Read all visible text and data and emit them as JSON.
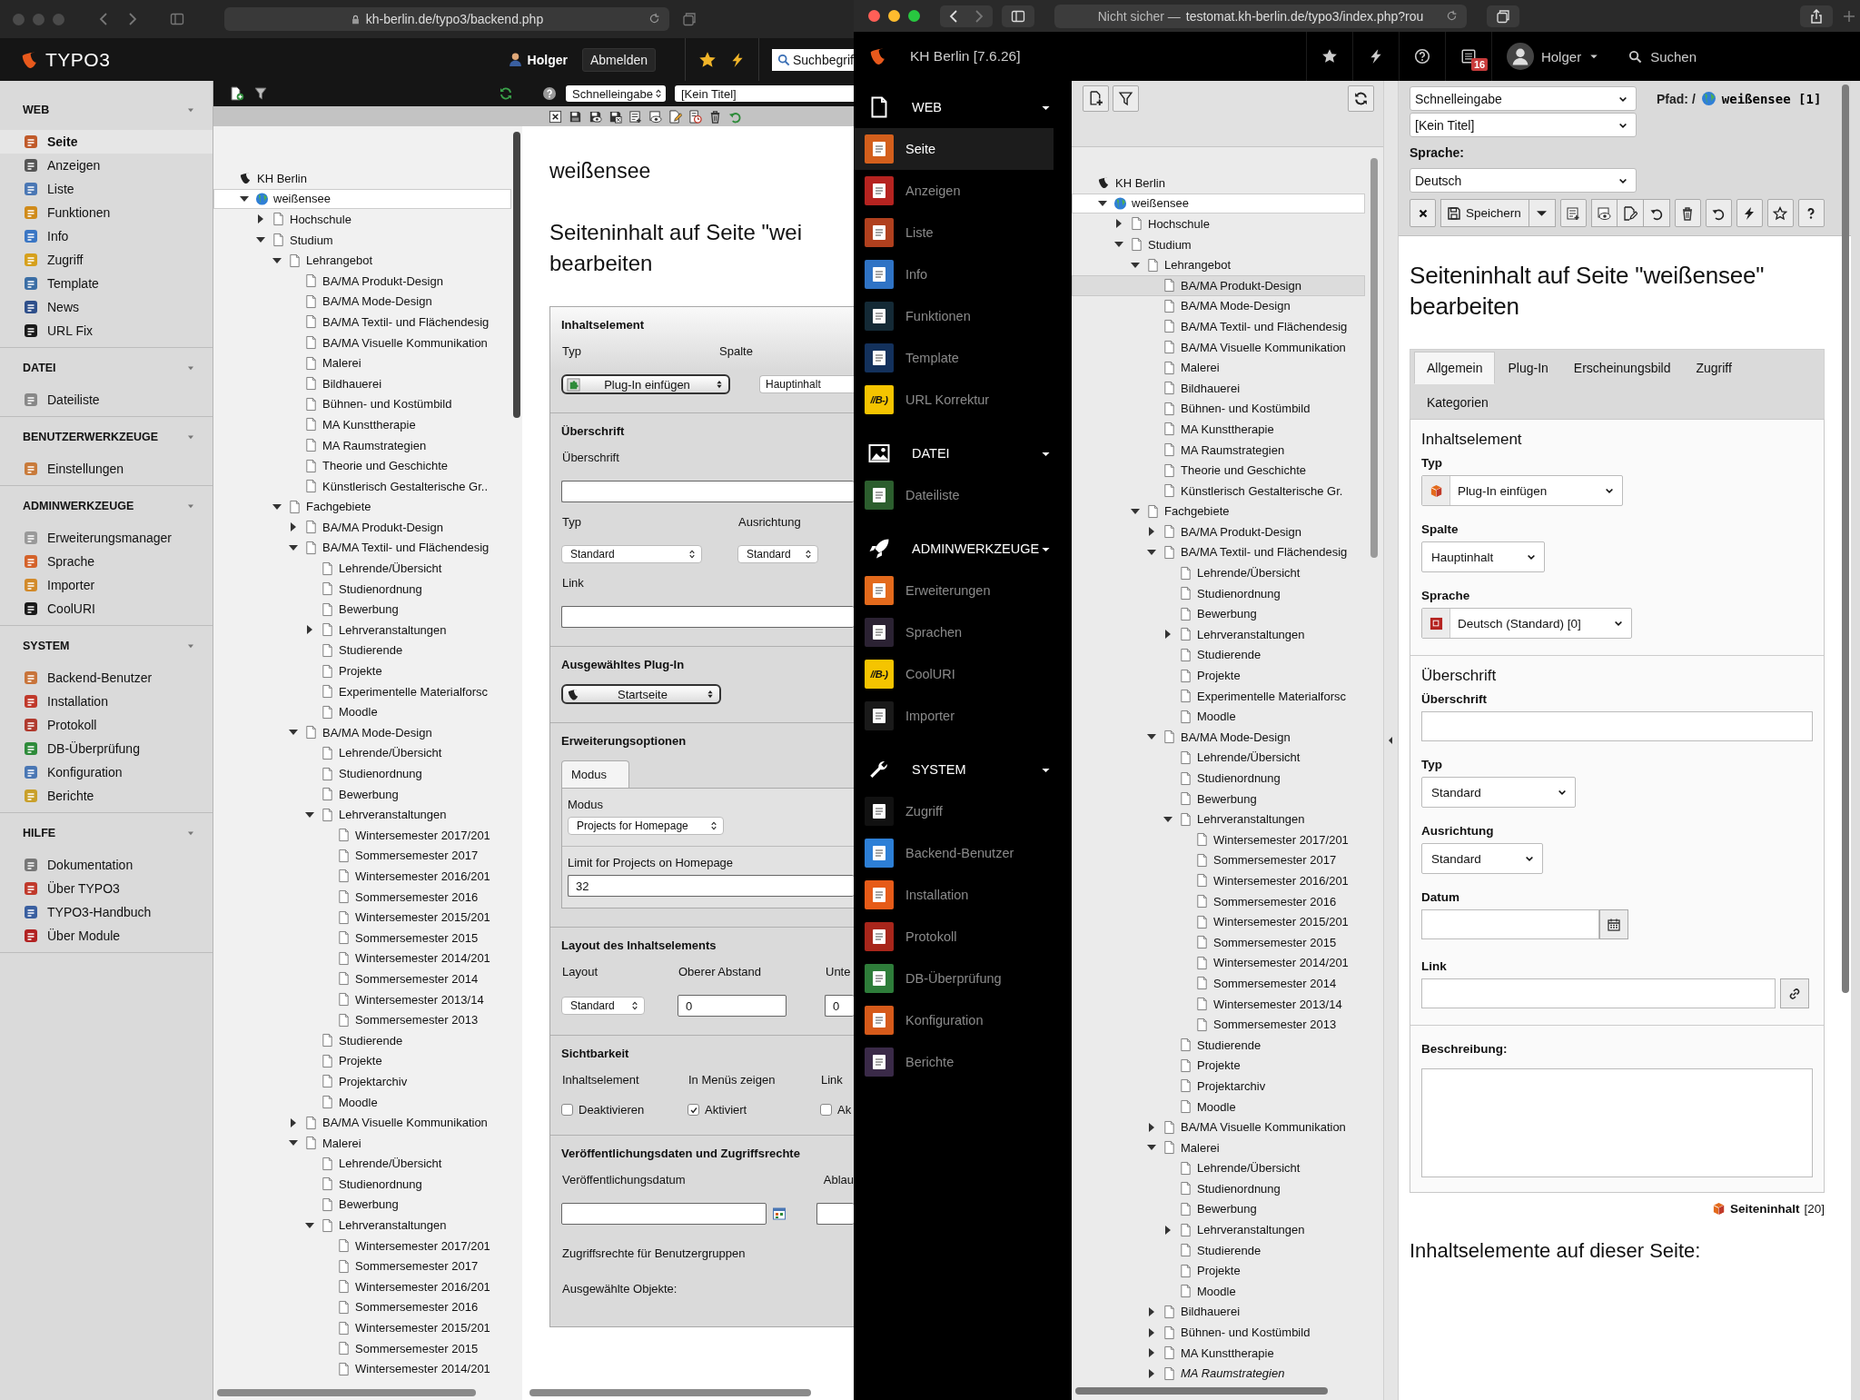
{
  "left_window": {
    "address_bar": "kh-berlin.de/typo3/backend.php",
    "brand": "TYPO3",
    "user": "Holger",
    "logout_button": "Abmelden",
    "search": {
      "value": "Suchbegrif"
    },
    "modules": [
      {
        "title": "WEB",
        "items": [
          {
            "label": "Seite",
            "selected": true,
            "color": "#c05a2a"
          },
          {
            "label": "Anzeigen",
            "selected": false,
            "color": "#555555"
          },
          {
            "label": "Liste",
            "selected": false,
            "color": "#4a77b4"
          },
          {
            "label": "Funktionen",
            "selected": false,
            "color": "#d08b1a"
          },
          {
            "label": "Info",
            "selected": false,
            "color": "#3a76c4"
          },
          {
            "label": "Zugriff",
            "selected": false,
            "color": "#d6a01c"
          },
          {
            "label": "Template",
            "selected": false,
            "color": "#3b6ea5"
          },
          {
            "label": "News",
            "selected": false,
            "color": "#2e4f8a"
          },
          {
            "label": "URL Fix",
            "selected": false,
            "color": "#1a1a1a"
          }
        ]
      },
      {
        "title": "DATEI",
        "items": [
          {
            "label": "Dateiliste",
            "selected": false,
            "color": "#888888"
          }
        ]
      },
      {
        "title": "BENUTZERWERKZEUGE",
        "items": [
          {
            "label": "Einstellungen",
            "selected": false,
            "color": "#c87a3a"
          }
        ]
      },
      {
        "title": "ADMINWERKZEUGE",
        "items": [
          {
            "label": "Erweiterungsmanager",
            "selected": false,
            "color": "#999999"
          },
          {
            "label": "Sprache",
            "selected": false,
            "color": "#d4622a"
          },
          {
            "label": "Importer",
            "selected": false,
            "color": "#d28a2a"
          },
          {
            "label": "CoolURI",
            "selected": false,
            "color": "#1a1a1a"
          }
        ]
      },
      {
        "title": "SYSTEM",
        "items": [
          {
            "label": "Backend-Benutzer",
            "selected": false,
            "color": "#c8743a"
          },
          {
            "label": "Installation",
            "selected": false,
            "color": "#c0392b"
          },
          {
            "label": "Protokoll",
            "selected": false,
            "color": "#b03a2e"
          },
          {
            "label": "DB-Überprüfung",
            "selected": false,
            "color": "#2e8b3a"
          },
          {
            "label": "Konfiguration",
            "selected": false,
            "color": "#4a77b4"
          },
          {
            "label": "Berichte",
            "selected": false,
            "color": "#c9a02a"
          }
        ]
      },
      {
        "title": "HILFE",
        "items": [
          {
            "label": "Dokumentation",
            "selected": false,
            "color": "#777777"
          },
          {
            "label": "Über TYPO3",
            "selected": false,
            "color": "#c0392b"
          },
          {
            "label": "TYPO3-Handbuch",
            "selected": false,
            "color": "#3a5fa0"
          },
          {
            "label": "Über Module",
            "selected": false,
            "color": "#b22222"
          }
        ]
      }
    ],
    "toolbar": {
      "quick_select": "Schnelleingabe",
      "title_select": "[Kein Titel]"
    },
    "tree": [
      {
        "label": "KH Berlin",
        "children": [
          {
            "label": "weißensee",
            "expanded": true,
            "selected": true,
            "children": [
              {
                "label": "Hochschule",
                "expanded": false
              },
              {
                "label": "Studium",
                "expanded": true,
                "children": [
                  {
                    "label": "Lehrangebot",
                    "expanded": true,
                    "children": [
                      {
                        "label": "BA/MA Produkt-Design"
                      },
                      {
                        "label": "BA/MA Mode-Design"
                      },
                      {
                        "label": "BA/MA Textil- und Flächendesig"
                      },
                      {
                        "label": "BA/MA Visuelle Kommunikation"
                      },
                      {
                        "label": "Malerei"
                      },
                      {
                        "label": "Bildhauerei"
                      },
                      {
                        "label": "Bühnen- und Kostümbild"
                      },
                      {
                        "label": "MA Kunsttherapie"
                      },
                      {
                        "label": "MA Raumstrategien"
                      },
                      {
                        "label": "Theorie und Geschichte"
                      },
                      {
                        "label": "Künstlerisch Gestalterische Gr.."
                      }
                    ]
                  },
                  {
                    "label": "Fachgebiete",
                    "expanded": true,
                    "children": [
                      {
                        "label": "BA/MA Produkt-Design",
                        "expanded": false
                      },
                      {
                        "label": "BA/MA Textil- und Flächendesig",
                        "expanded": true,
                        "children": [
                          {
                            "label": "Lehrende/Übersicht"
                          },
                          {
                            "label": "Studienordnung"
                          },
                          {
                            "label": "Bewerbung"
                          },
                          {
                            "label": "Lehrveranstaltungen",
                            "expanded": false
                          },
                          {
                            "label": "Studierende"
                          },
                          {
                            "label": "Projekte"
                          },
                          {
                            "label": "Experimentelle Materialforsc"
                          },
                          {
                            "label": "Moodle"
                          }
                        ]
                      },
                      {
                        "label": "BA/MA Mode-Design",
                        "expanded": true,
                        "children": [
                          {
                            "label": "Lehrende/Übersicht"
                          },
                          {
                            "label": "Studienordnung"
                          },
                          {
                            "label": "Bewerbung"
                          },
                          {
                            "label": "Lehrveranstaltungen",
                            "expanded": true,
                            "children": [
                              {
                                "label": "Wintersemester 2017/201"
                              },
                              {
                                "label": "Sommersemester 2017"
                              },
                              {
                                "label": "Wintersemester 2016/201"
                              },
                              {
                                "label": "Sommersemester 2016"
                              },
                              {
                                "label": "Wintersemester 2015/201"
                              },
                              {
                                "label": "Sommersemester 2015"
                              },
                              {
                                "label": "Wintersemester 2014/201"
                              },
                              {
                                "label": "Sommersemester 2014"
                              },
                              {
                                "label": "Wintersemester 2013/14"
                              },
                              {
                                "label": "Sommersemester 2013"
                              }
                            ]
                          },
                          {
                            "label": "Studierende"
                          },
                          {
                            "label": "Projekte"
                          },
                          {
                            "label": "Projektarchiv"
                          },
                          {
                            "label": "Moodle"
                          }
                        ]
                      },
                      {
                        "label": "BA/MA Visuelle Kommunikation",
                        "expanded": false
                      },
                      {
                        "label": "Malerei",
                        "expanded": true,
                        "children": [
                          {
                            "label": "Lehrende/Übersicht"
                          },
                          {
                            "label": "Studienordnung"
                          },
                          {
                            "label": "Bewerbung"
                          },
                          {
                            "label": "Lehrveranstaltungen",
                            "expanded": true,
                            "children": [
                              {
                                "label": "Wintersemester 2017/201"
                              },
                              {
                                "label": "Sommersemester 2017"
                              },
                              {
                                "label": "Wintersemester 2016/201"
                              },
                              {
                                "label": "Sommersemester 2016"
                              },
                              {
                                "label": "Wintersemester 2015/201"
                              },
                              {
                                "label": "Sommersemester 2015"
                              },
                              {
                                "label": "Wintersemester 2014/201"
                              }
                            ]
                          }
                        ]
                      }
                    ]
                  }
                ]
              }
            ]
          }
        ]
      }
    ],
    "page_title": "weißensee",
    "heading_lines": [
      "Seiteninhalt auf Seite \"wei",
      "bearbeiten"
    ],
    "form": {
      "content_element": {
        "title": "Inhaltselement",
        "type_label": "Typ",
        "type_value": "Plug-In einfügen",
        "column_label": "Spalte",
        "column_value": "Hauptinhalt"
      },
      "header": {
        "title": "Überschrift",
        "header_label": "Überschrift",
        "type_label": "Typ",
        "type_value": "Standard",
        "align_label": "Ausrichtung",
        "align_value": "Standard",
        "link_label": "Link"
      },
      "plugin": {
        "title": "Ausgewähltes Plug-In",
        "value": "Startseite"
      },
      "extension": {
        "title": "Erweiterungsoptionen",
        "tab": "Modus",
        "mode_label": "Modus",
        "mode_value": "Projects for Homepage",
        "limit_label": "Limit for Projects on Homepage",
        "limit_value": "32"
      },
      "layout": {
        "title": "Layout des Inhaltselements",
        "layout_label": "Layout",
        "layout_value": "Standard",
        "top_label": "Oberer Abstand",
        "top_value": "0",
        "column_3_label": "Unte",
        "column_3_value": "0"
      },
      "visibility": {
        "title": "Sichtbarkeit",
        "columns": [
          {
            "label": "Inhaltselement",
            "option": "Deaktivieren",
            "checked": false
          },
          {
            "label": "In Menüs zeigen",
            "option": "Aktiviert",
            "checked": true
          },
          {
            "label": "Link",
            "option": "Ak",
            "checked": false
          }
        ]
      },
      "access": {
        "title": "Veröffentlichungsdaten und Zugriffsrechte",
        "start_label": "Veröffentlichungsdatum",
        "column_2_label": "Ablau",
        "groups_label": "Zugriffsrechte für Benutzergruppen",
        "selected_label": "Ausgewählte Objekte:"
      }
    }
  },
  "right_window": {
    "insecure_label": "Nicht sicher —",
    "url": "testomat.kh-berlin.de/typo3/index.php?rou",
    "site_name": "KH Berlin [7.6.26]",
    "badge": "16",
    "user": "Holger",
    "search_label": "Suchen",
    "modules": [
      {
        "title": "WEB",
        "items": [
          {
            "label": "Seite",
            "selected": true,
            "color": "#d35f1c"
          },
          {
            "label": "Anzeigen",
            "selected": false,
            "color": "#b52320"
          },
          {
            "label": "Liste",
            "selected": false,
            "color": "#b0401e"
          },
          {
            "label": "Info",
            "selected": false,
            "color": "#2f73c5"
          },
          {
            "label": "Funktionen",
            "selected": false,
            "color": "#142a36"
          },
          {
            "label": "Template",
            "selected": false,
            "color": "#13315c"
          },
          {
            "label": "URL Korrektur",
            "selected": false,
            "color": "#f5c400",
            "logo": "//B-)"
          }
        ]
      },
      {
        "title": "DATEI",
        "items": [
          {
            "label": "Dateiliste",
            "selected": false,
            "color": "#2c5e2e"
          }
        ]
      },
      {
        "title": "ADMINWERKZEUGE",
        "items": [
          {
            "label": "Erweiterungen",
            "selected": false,
            "color": "#e36a1c"
          },
          {
            "label": "Sprachen",
            "selected": false,
            "color": "#2b2233"
          },
          {
            "label": "CoolURI",
            "selected": false,
            "color": "#f5c400",
            "logo": "//B-)"
          },
          {
            "label": "Importer",
            "selected": false,
            "color": "#1a1a1a"
          }
        ]
      },
      {
        "title": "SYSTEM",
        "items": [
          {
            "label": "Zugriff",
            "selected": false,
            "color": "#111111"
          },
          {
            "label": "Backend-Benutzer",
            "selected": false,
            "color": "#2d7fd6"
          },
          {
            "label": "Installation",
            "selected": false,
            "color": "#e65b18"
          },
          {
            "label": "Protokoll",
            "selected": false,
            "color": "#a8261b"
          },
          {
            "label": "DB-Überprüfung",
            "selected": false,
            "color": "#2e7d3a"
          },
          {
            "label": "Konfiguration",
            "selected": false,
            "color": "#d65a1a"
          },
          {
            "label": "Berichte",
            "selected": false,
            "color": "#3a2a48"
          }
        ]
      }
    ],
    "tree": [
      {
        "label": "KH Berlin",
        "children": [
          {
            "label": "weißensee",
            "expanded": true,
            "selected": true,
            "children": [
              {
                "label": "Hochschule",
                "expanded": false
              },
              {
                "label": "Studium",
                "expanded": true,
                "children": [
                  {
                    "label": "Lehrangebot",
                    "expanded": true,
                    "children": [
                      {
                        "label": "BA/MA Produkt-Design",
                        "highlighted": true
                      },
                      {
                        "label": "BA/MA Mode-Design"
                      },
                      {
                        "label": "BA/MA Textil- und Flächendesig"
                      },
                      {
                        "label": "BA/MA Visuelle Kommunikation"
                      },
                      {
                        "label": "Malerei"
                      },
                      {
                        "label": "Bildhauerei"
                      },
                      {
                        "label": "Bühnen- und Kostümbild"
                      },
                      {
                        "label": "MA Kunsttherapie"
                      },
                      {
                        "label": "MA Raumstrategien"
                      },
                      {
                        "label": "Theorie und Geschichte"
                      },
                      {
                        "label": "Künstlerisch Gestalterische Gr."
                      }
                    ]
                  },
                  {
                    "label": "Fachgebiete",
                    "expanded": true,
                    "children": [
                      {
                        "label": "BA/MA Produkt-Design",
                        "expanded": false
                      },
                      {
                        "label": "BA/MA Textil- und Flächendesig",
                        "expanded": true,
                        "children": [
                          {
                            "label": "Lehrende/Übersicht"
                          },
                          {
                            "label": "Studienordnung"
                          },
                          {
                            "label": "Bewerbung"
                          },
                          {
                            "label": "Lehrveranstaltungen",
                            "expanded": false
                          },
                          {
                            "label": "Studierende"
                          },
                          {
                            "label": "Projekte"
                          },
                          {
                            "label": "Experimentelle Materialforsc"
                          },
                          {
                            "label": "Moodle"
                          }
                        ]
                      },
                      {
                        "label": "BA/MA Mode-Design",
                        "expanded": true,
                        "children": [
                          {
                            "label": "Lehrende/Übersicht"
                          },
                          {
                            "label": "Studienordnung"
                          },
                          {
                            "label": "Bewerbung"
                          },
                          {
                            "label": "Lehrveranstaltungen",
                            "expanded": true,
                            "children": [
                              {
                                "label": "Wintersemester 2017/201"
                              },
                              {
                                "label": "Sommersemester 2017"
                              },
                              {
                                "label": "Wintersemester 2016/201"
                              },
                              {
                                "label": "Sommersemester 2016"
                              },
                              {
                                "label": "Wintersemester 2015/201"
                              },
                              {
                                "label": "Sommersemester 2015"
                              },
                              {
                                "label": "Wintersemester 2014/201"
                              },
                              {
                                "label": "Sommersemester 2014"
                              },
                              {
                                "label": "Wintersemester 2013/14"
                              },
                              {
                                "label": "Sommersemester 2013"
                              }
                            ]
                          },
                          {
                            "label": "Studierende"
                          },
                          {
                            "label": "Projekte"
                          },
                          {
                            "label": "Projektarchiv"
                          },
                          {
                            "label": "Moodle"
                          }
                        ]
                      },
                      {
                        "label": "BA/MA Visuelle Kommunikation",
                        "expanded": false
                      },
                      {
                        "label": "Malerei",
                        "expanded": true,
                        "children": [
                          {
                            "label": "Lehrende/Übersicht"
                          },
                          {
                            "label": "Studienordnung"
                          },
                          {
                            "label": "Bewerbung"
                          },
                          {
                            "label": "Lehrveranstaltungen",
                            "expanded": false
                          },
                          {
                            "label": "Studierende"
                          },
                          {
                            "label": "Projekte"
                          },
                          {
                            "label": "Moodle"
                          }
                        ]
                      },
                      {
                        "label": "Bildhauerei",
                        "expanded": false
                      },
                      {
                        "label": "Bühnen- und Kostümbild",
                        "expanded": false
                      },
                      {
                        "label": "MA Kunsttherapie",
                        "expanded": false
                      },
                      {
                        "label": "MA Raumstrategien",
                        "expanded": false,
                        "hidden": true
                      }
                    ]
                  }
                ]
              }
            ]
          }
        ]
      }
    ],
    "docheader": {
      "quick_select": "Schnelleingabe",
      "title_select": "[Kein Titel]",
      "language_label": "Sprache:",
      "language_value": "Deutsch",
      "path_label": "Pfad: /",
      "path_page": "weißensee [1]",
      "save_button": "Speichern"
    },
    "heading": "Seiteninhalt auf Seite \"weißensee\" bearbeiten",
    "tabs": [
      {
        "label": "Allgemein",
        "selected": true
      },
      {
        "label": "Plug-In",
        "selected": false
      },
      {
        "label": "Erscheinungsbild",
        "selected": false
      },
      {
        "label": "Zugriff",
        "selected": false
      },
      {
        "label": "Kategorien",
        "selected": false
      }
    ],
    "content_element": {
      "title": "Inhaltselement",
      "fields": [
        {
          "kind": "icon_select",
          "label": "Typ",
          "value": "Plug-In einfügen"
        },
        {
          "kind": "select",
          "label": "Spalte",
          "value": "Hauptinhalt"
        },
        {
          "kind": "icon_select",
          "label": "Sprache",
          "value": "Deutsch (Standard) [0]"
        }
      ]
    },
    "header": {
      "title": "Überschrift",
      "fields": [
        {
          "kind": "input",
          "label": "Überschrift"
        },
        {
          "kind": "select",
          "label": "Typ",
          "value": "Standard"
        },
        {
          "kind": "select",
          "label": "Ausrichtung",
          "value": "Standard"
        },
        {
          "kind": "date",
          "label": "Datum"
        },
        {
          "kind": "link",
          "label": "Link"
        }
      ]
    },
    "description": {
      "label": "Beschreibung:"
    },
    "record": {
      "label": "Seiteninhalt",
      "id": "[20]"
    },
    "subheading": "Inhaltselemente auf dieser Seite:"
  }
}
